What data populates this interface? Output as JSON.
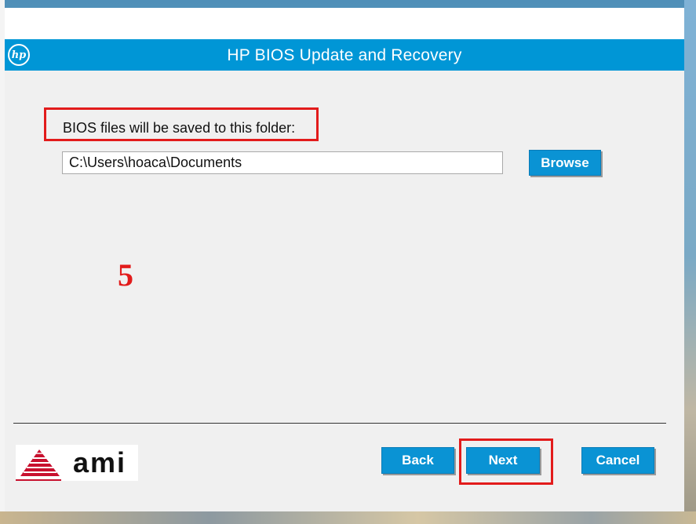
{
  "window": {
    "title": "HP BIOS Update and Recovery",
    "logo_icon": "hp-logo-icon",
    "accent_color": "#0096d6"
  },
  "main": {
    "folder_label": "BIOS files will be saved to this folder:",
    "folder_path_value": "C:\\Users\\hoaca\\Documents",
    "browse_label": "Browse",
    "step_annotation": "5",
    "annotation_color": "#e21b1b"
  },
  "footer": {
    "vendor_logo_text": "ami",
    "back_label": "Back",
    "next_label": "Next",
    "cancel_label": "Cancel"
  }
}
